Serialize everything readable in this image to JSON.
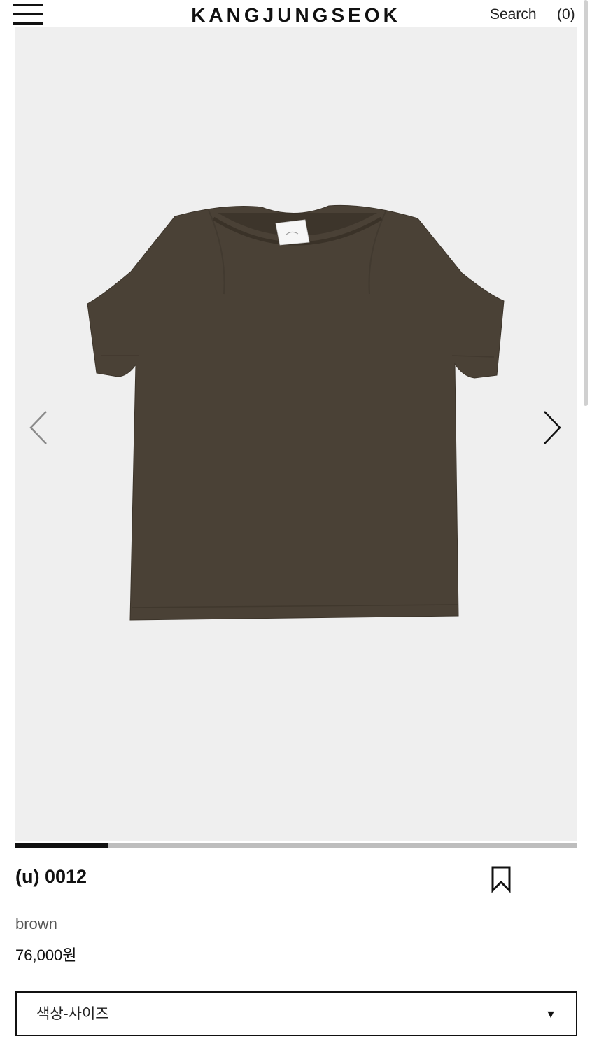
{
  "header": {
    "menu_icon": "hamburger-menu-icon",
    "logo_text": "KANGJUNGSEOK",
    "search_label": "Search",
    "cart_label": "(0)"
  },
  "gallery": {
    "background_color": "#efefef",
    "image_subject": "brown short-sleeve t-shirt",
    "prev_icon": "chevron-left-icon",
    "next_icon": "chevron-right-icon",
    "progress_fraction": 0.165
  },
  "product": {
    "name": "(u) 0012",
    "color": "brown",
    "price": "76,000원",
    "bookmark_icon": "bookmark-icon",
    "garment_color": "#4a4136"
  },
  "options": {
    "select_label": "색상-사이즈",
    "caret_icon": "▼"
  }
}
